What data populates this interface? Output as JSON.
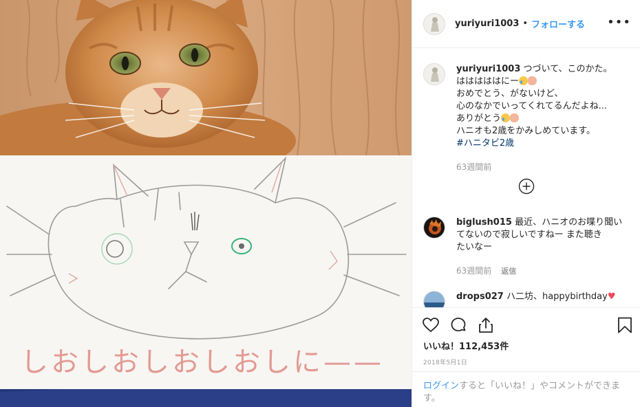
{
  "post": {
    "username": "yuriyuri1003",
    "separator": "•",
    "follow_label": "フォローする",
    "more_label": "•••"
  },
  "caption": {
    "username": "yuriyuri1003",
    "lines": [
      "つづいて、このかた。",
      "はははははにー",
      "おめでとう、がないけど、",
      "心のなかでいってくれてるんだよね...",
      "ありがとう",
      "ハニオも2歳をかみしめています。"
    ],
    "hashtag": "#ハニタビ2歳",
    "time": "63週間前"
  },
  "comments": [
    {
      "username": "biglush015",
      "lines": [
        "最近、ハニオのお喋り聞い",
        "てないので寂しいですねー また聴き",
        "たいなー"
      ],
      "time": "63週間前",
      "reply_label": "返信"
    },
    {
      "username": "drops027",
      "text": "ハ二坊、happybirthday"
    }
  ],
  "icons": {
    "like": "heart-outline-icon",
    "comment": "comment-bubble-icon",
    "share": "share-icon",
    "save": "bookmark-icon",
    "load_more": "plus-circle-icon"
  },
  "likes": "いいね！112,453件",
  "date": "2018年5月1日",
  "login_prompt": {
    "link": "ログイン",
    "text": "すると「いいね！」やコメントができます。"
  },
  "drawing_text": "しおしおしおしおしに——",
  "colors": {
    "accent": "#3897f0",
    "heart": "#ed4956",
    "hashtag": "#003569",
    "muted": "#999999"
  }
}
